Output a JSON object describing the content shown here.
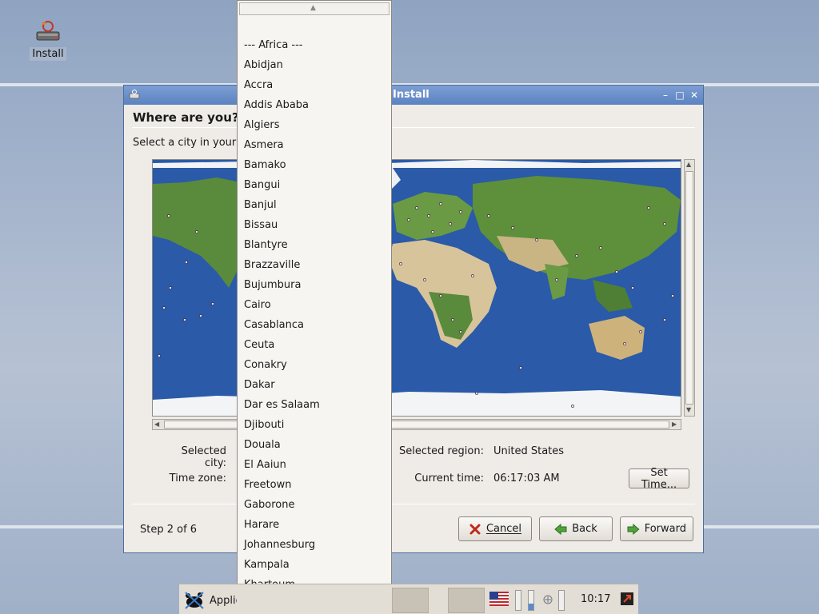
{
  "desktop": {
    "install_icon_label": "Install"
  },
  "window": {
    "title": "Install",
    "heading": "Where are you?",
    "instruction": "Select a city in your country and time zone.",
    "selected_city_label": "Selected city:",
    "selected_city_value": "",
    "time_zone_label": "Time zone:",
    "time_zone_value": "",
    "selected_region_label": "Selected region:",
    "selected_region_value": "United States",
    "current_time_label": "Current time:",
    "current_time_value": "06:17:03 AM",
    "set_time_button": "Set Time...",
    "step_text": "Step 2 of 6",
    "cancel_button": "Cancel",
    "back_button": "Back",
    "forward_button": "Forward"
  },
  "dropdown": {
    "items": [
      "--- Africa ---",
      "Abidjan",
      "Accra",
      "Addis Ababa",
      "Algiers",
      "Asmera",
      "Bamako",
      "Bangui",
      "Banjul",
      "Bissau",
      "Blantyre",
      "Brazzaville",
      "Bujumbura",
      "Cairo",
      "Casablanca",
      "Ceuta",
      "Conakry",
      "Dakar",
      "Dar es Salaam",
      "Djibouti",
      "Douala",
      "El Aaiun",
      "Freetown",
      "Gaborone",
      "Harare",
      "Johannesburg",
      "Kampala",
      "Khartoum"
    ]
  },
  "taskbar": {
    "applications_label": "Applications",
    "clock": "10:17"
  },
  "colors": {
    "ocean": "#2a5aa8",
    "land_green": "#5a8a3c",
    "desert": "#d8c49a",
    "ice": "#f2f4f6",
    "titlebar": "#5a82c2"
  }
}
